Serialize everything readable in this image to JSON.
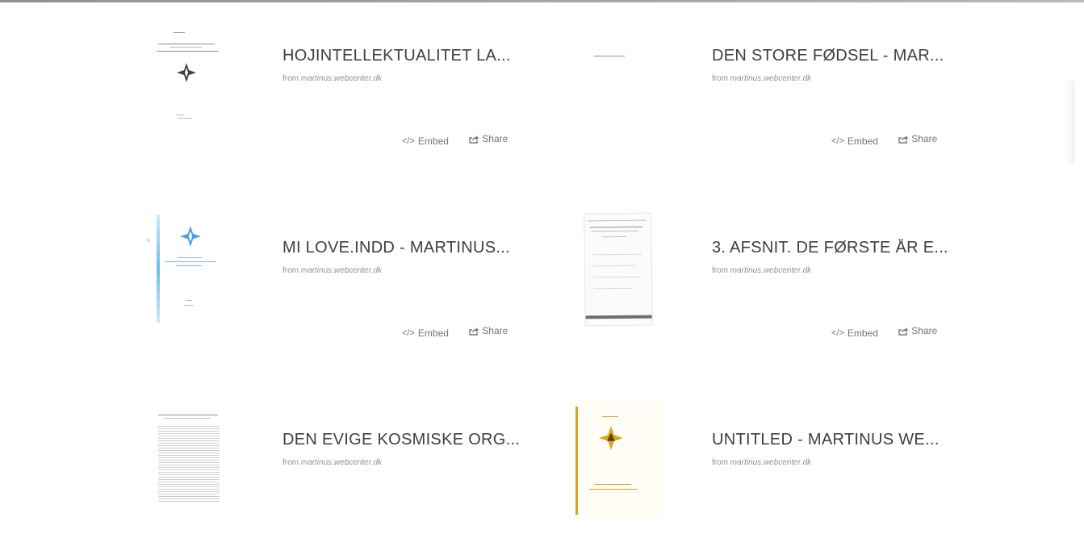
{
  "cards": [
    {
      "title": "HOJINTELLEKTUALITET LA...",
      "source_prefix": "from ",
      "source_site": "martinus.webcenter.dk",
      "embed": "Embed",
      "share": "Share",
      "thumb": "thumbnail-cosmic-star-document"
    },
    {
      "title": "DEN STORE FØDSEL - MAR...",
      "source_prefix": "from ",
      "source_site": "martinus.webcenter.dk",
      "embed": "Embed",
      "share": "Share",
      "thumb": "thumbnail-blank-document"
    },
    {
      "title": "MI LOVE.INDD - MARTINUS...",
      "source_prefix": "from ",
      "source_site": "martinus.webcenter.dk",
      "embed": "Embed",
      "share": "Share",
      "thumb": "thumbnail-blue-star-document"
    },
    {
      "title": "3. AFSNIT. DE FØRSTE ÅR E...",
      "source_prefix": "from ",
      "source_site": "martinus.webcenter.dk",
      "embed": "Embed",
      "share": "Share",
      "thumb": "thumbnail-text-page"
    },
    {
      "title": "DEN EVIGE KOSMISKE ORG...",
      "source_prefix": "from ",
      "source_site": "martinus.webcenter.dk",
      "embed": "Embed",
      "share": "Share",
      "thumb": "thumbnail-dense-text-page"
    },
    {
      "title": "UNTITLED - MARTINUS WE...",
      "source_prefix": "from ",
      "source_site": "martinus.webcenter.dk",
      "embed": "Embed",
      "share": "Share",
      "thumb": "thumbnail-gold-cover"
    }
  ],
  "icons": {
    "embed": "code-icon",
    "share": "share-icon"
  },
  "colors": {
    "title": "#3b3f44",
    "muted": "#8b9199",
    "accent_blue": "#4aa3df",
    "gold": "#d9a521"
  }
}
